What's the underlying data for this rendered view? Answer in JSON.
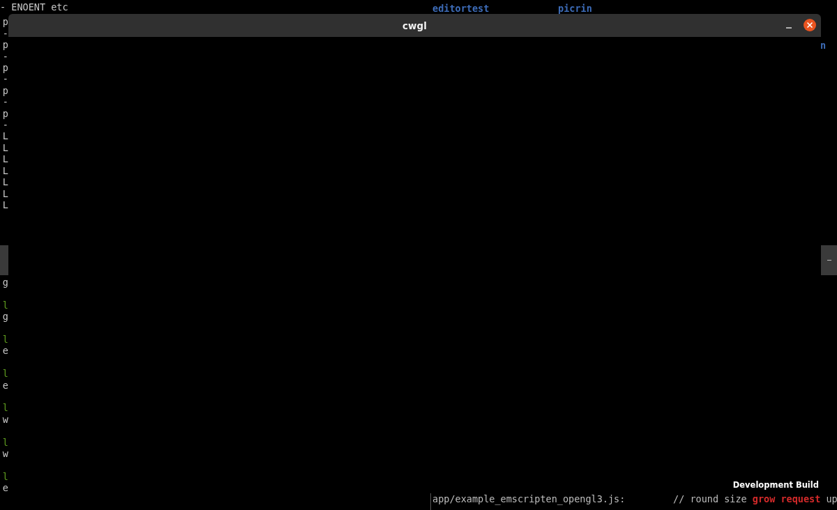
{
  "desktop": {
    "left_terminal": {
      "upper": [
        {
          "text": "- ENOENT etc",
          "kind": "plain"
        },
        {
          "text": "p",
          "kind": "plain"
        },
        {
          "text": "-",
          "kind": "plain"
        },
        {
          "text": "p",
          "kind": "plain"
        },
        {
          "text": "-",
          "kind": "plain"
        },
        {
          "text": "p",
          "kind": "plain"
        },
        {
          "text": "-",
          "kind": "plain"
        },
        {
          "text": "p",
          "kind": "plain"
        },
        {
          "text": "-",
          "kind": "plain"
        },
        {
          "text": "p",
          "kind": "plain"
        },
        {
          "text": "-",
          "kind": "plain"
        },
        {
          "text": "L",
          "kind": "plain"
        },
        {
          "text": "L",
          "kind": "plain"
        },
        {
          "text": "L",
          "kind": "plain"
        },
        {
          "text": "L",
          "kind": "plain"
        },
        {
          "text": "L",
          "kind": "plain"
        },
        {
          "text": "L",
          "kind": "plain"
        },
        {
          "text": "L",
          "kind": "plain"
        }
      ],
      "lower": [
        [
          {
            "text": "g",
            "kind": "plain"
          }
        ],
        [
          {
            "text": "l",
            "kind": "package"
          },
          {
            "text": "g",
            "kind": "plain"
          }
        ],
        [
          {
            "text": "l",
            "kind": "package"
          },
          {
            "text": "e",
            "kind": "plain"
          }
        ],
        [
          {
            "text": "l",
            "kind": "package"
          },
          {
            "text": "e",
            "kind": "plain"
          }
        ],
        [
          {
            "text": "l",
            "kind": "package"
          },
          {
            "text": "w",
            "kind": "plain"
          }
        ],
        [
          {
            "text": "l",
            "kind": "package"
          },
          {
            "text": "w",
            "kind": "plain"
          }
        ],
        [
          {
            "text": "l",
            "kind": "package"
          },
          {
            "text": "e",
            "kind": "plain"
          }
        ]
      ]
    },
    "top_terminal": {
      "rows": [
        [
          "editortest",
          "picrin"
        ]
      ],
      "edge_text": "n"
    },
    "bottom_terminal": {
      "lines": [
        [
          {
            "text": "app/example_emscripten_opengl3.js:",
            "kind": "plain"
          },
          {
            "text": "// round size ",
            "kind": "comment"
          },
          {
            "text": "grow request",
            "kind": "keyword"
          },
          {
            "text": " up",
            "kind": "comment"
          }
        ]
      ]
    }
  },
  "window": {
    "title": "cwgl",
    "overlay_text": "Development Build"
  }
}
